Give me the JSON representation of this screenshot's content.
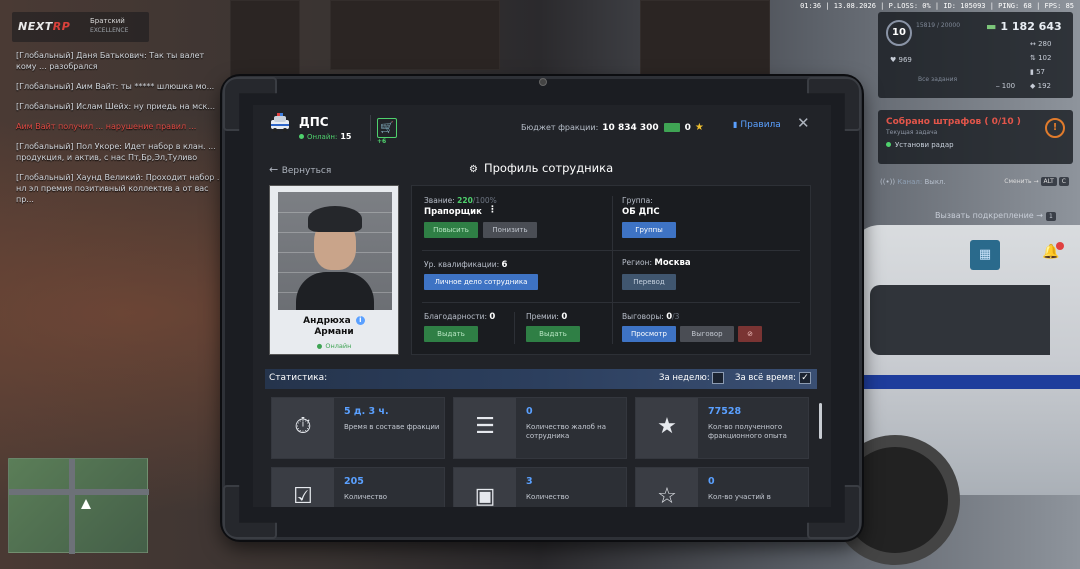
{
  "hud": {
    "top_info": "01:36 | 13.08.2026 | P.LOSS: 0% | ID: 105093 | PING: 68 | FPS: 85",
    "level": "10",
    "level_sub": "15819 / 20000",
    "money": "1 182 643",
    "armor": "969",
    "shield_label": "Все задания",
    "stat_280": "280",
    "stat_102": "102",
    "stat_57": "57",
    "stat_100": "100",
    "stat_192": "192"
  },
  "task": {
    "title": "Собрано штрафов ( 0/10 )",
    "subtitle": "Текущая задача",
    "step": "Установи радар"
  },
  "radio": {
    "label": "Канал:",
    "value": "Выкл.",
    "switch_label": "Сменить →",
    "key1": "ALT",
    "key2": "C"
  },
  "backup": {
    "label": "Вызвать подкрепление →",
    "key": "1"
  },
  "logo": {
    "brand_a": "NEXT",
    "brand_b": "RP",
    "server": "Братский",
    "server_sub": "EXCELLENCE"
  },
  "chat": [
    "[Глобальный] Даня Батькович: Так ты валет кому ... разобрался",
    "[Глобальный] Аим Вайт: ты ***** шлюшка мо...",
    "[Глобальный] Ислам Шейх: ну приедь на мск...",
    "Аим Вайт получил ... нарушение правил ...",
    "[Глобальный] Пол Укоре: Идет набор в клан. ... продукция, и актив, с нас Пт,Бр,Эл,Туливо",
    "[Глобальный] Хаунд Великий: Проходит набор ... нл эл премия позитивный коллектив а от вас пр..."
  ],
  "faction": {
    "name": "ДПС",
    "online_label": "Онлайн:",
    "online_count": "15",
    "cart_badge": "+6",
    "budget_label": "Бюджет фракции:",
    "budget_value": "10 834 300",
    "coins": "0",
    "rules": "Правила",
    "close": "✕"
  },
  "nav": {
    "back": "Вернуться",
    "title": "Профиль сотрудника"
  },
  "profile": {
    "name_first": "Андрюха",
    "name_last": "Армани",
    "status": "Онлайн",
    "rank_label": "Звание:",
    "rank_num": "220",
    "rank_max": "/100%",
    "rank_name": "Прапорщик",
    "promote": "Повысить",
    "demote": "Понизить",
    "group_label": "Группа:",
    "group_value": "ОБ ДПС",
    "groups_btn": "Группы",
    "qual_label": "Ур. квалификации:",
    "qual_value": "6",
    "personal_file": "Личное дело сотрудника",
    "region_label": "Регион:",
    "region_value": "Москва",
    "transfer": "Перевод",
    "thanks_label": "Благодарности:",
    "thanks_value": "0",
    "thanks_btn": "Выдать",
    "bonus_label": "Премии:",
    "bonus_value": "0",
    "bonus_btn": "Выдать",
    "reprimand_label": "Выговоры:",
    "reprimand_value": "0",
    "reprimand_max": "/3",
    "view_btn": "Просмотр",
    "reprimand_btn": "Выговор",
    "remove_btn": "⊘"
  },
  "stats": {
    "label": "Статистика:",
    "week": "За неделю:",
    "all_time": "За всё время:",
    "week_checked": false,
    "all_checked": true,
    "cards": [
      {
        "value": "5 д. 3 ч.",
        "desc": "Время в составе фракции",
        "icon": "⏱"
      },
      {
        "value": "0",
        "desc": "Количество жалоб на сотрудника",
        "icon": "☰"
      },
      {
        "value": "77528",
        "desc": "Кол-во полученного фракционного опыта",
        "icon": "★"
      },
      {
        "value": "205",
        "desc": "Количество",
        "icon": "☑"
      },
      {
        "value": "3",
        "desc": "Количество",
        "icon": "▣"
      },
      {
        "value": "0",
        "desc": "Кол-во участий в",
        "icon": "☆"
      }
    ]
  }
}
